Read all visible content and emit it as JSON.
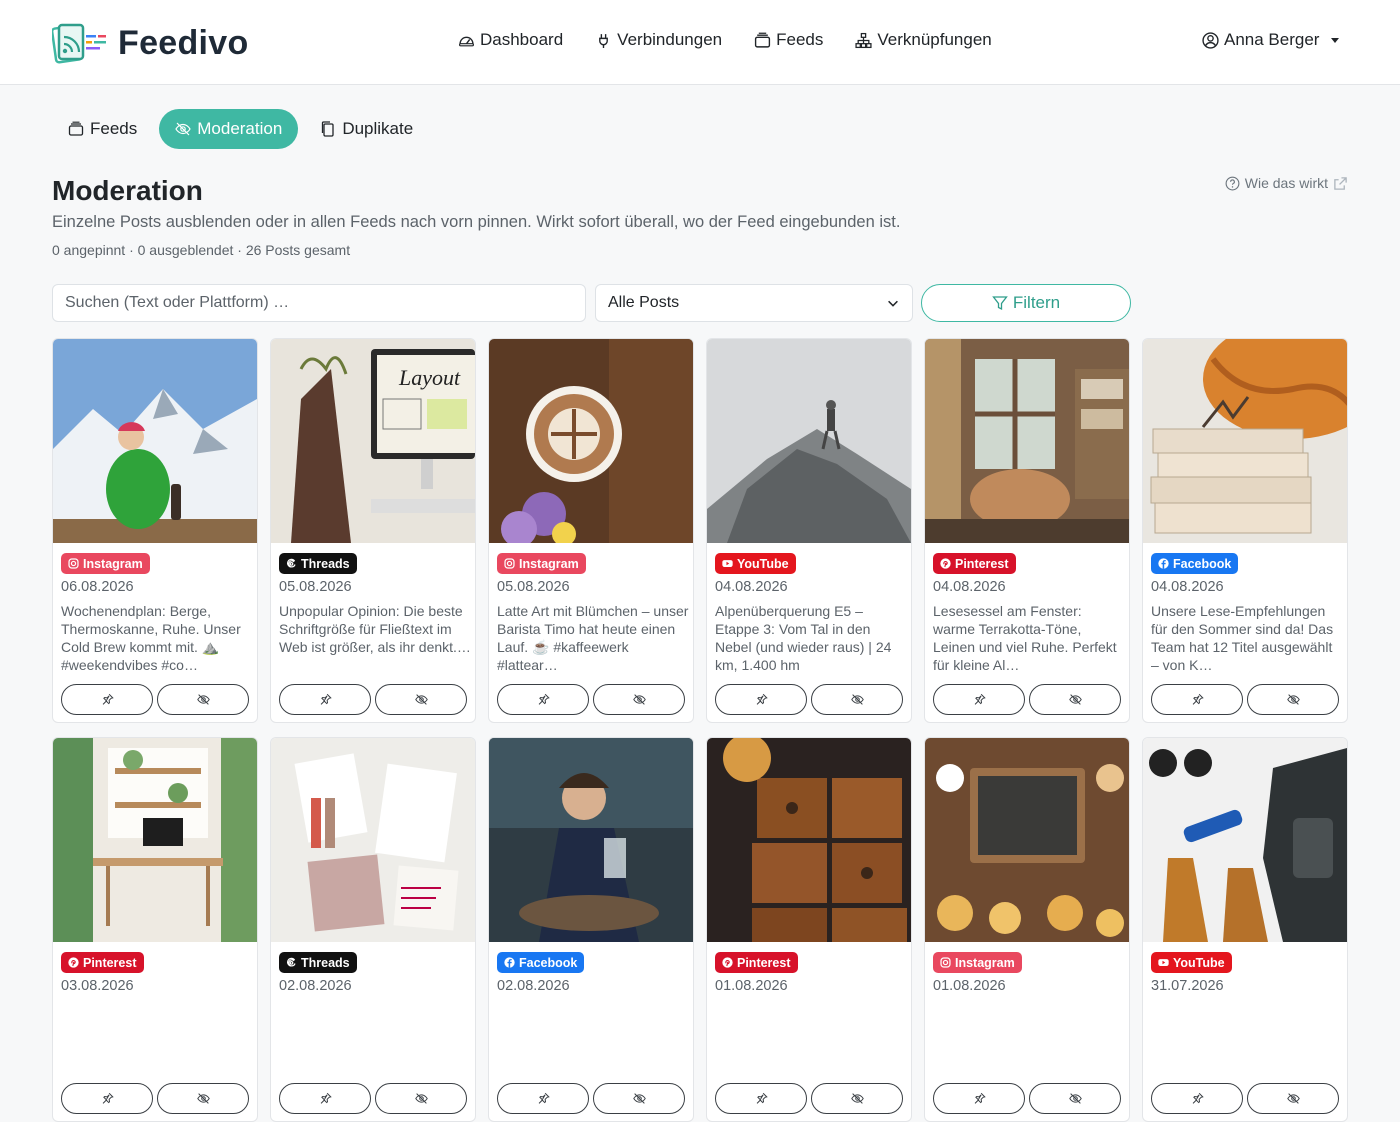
{
  "app": {
    "name": "Feedivo"
  },
  "nav": [
    {
      "label": "Dashboard",
      "icon": "speedometer-icon"
    },
    {
      "label": "Verbindungen",
      "icon": "plug-icon"
    },
    {
      "label": "Feeds",
      "icon": "stack-icon"
    },
    {
      "label": "Verknüpfungen",
      "icon": "diagram-icon"
    }
  ],
  "user": {
    "name": "Anna Berger"
  },
  "tabs": [
    {
      "label": "Feeds",
      "active": false
    },
    {
      "label": "Moderation",
      "active": true
    },
    {
      "label": "Duplikate",
      "active": false
    }
  ],
  "page": {
    "title": "Moderation",
    "description": "Einzelne Posts ausblenden oder in allen Feeds nach vorn pinnen. Wirkt sofort überall, wo der Feed eingebunden ist.",
    "stats": "0 angepinnt · 0 ausgeblendet · 26 Posts gesamt",
    "help": "Wie das wirkt"
  },
  "filter": {
    "search_placeholder": "Suchen (Text oder Plattform) …",
    "select_value": "Alle Posts",
    "button": "Filtern"
  },
  "platform_colors": {
    "Instagram": "#e9485f",
    "Threads": "#111111",
    "YouTube": "#e4161e",
    "Pinterest": "#d7122a",
    "Facebook": "#1877f2"
  },
  "posts": [
    {
      "platform": "Instagram",
      "date": "06.08.2026",
      "text": "Wochenendplan: Berge, Thermoskanne, Ruhe. Unser Cold Brew kommt mit. ⛰️ #weekendvibes #co…",
      "image": "mountain-hiker"
    },
    {
      "platform": "Threads",
      "date": "05.08.2026",
      "text": "Unpopular Opinion: Die beste Schriftgröße für Fließtext im Web ist größer, als ihr denkt.…",
      "image": "layout-monitor"
    },
    {
      "platform": "Instagram",
      "date": "05.08.2026",
      "text": "Latte Art mit Blümchen – unser Barista Timo hat heute einen Lauf. ☕ #kaffeewerk #lattear…",
      "image": "latte-art"
    },
    {
      "platform": "YouTube",
      "date": "04.08.2026",
      "text": "Alpenüberquerung E5 – Etappe 3: Vom Tal in den Nebel (und wieder raus) | 24 km, 1.400 hm",
      "image": "foggy-summit"
    },
    {
      "platform": "Pinterest",
      "date": "04.08.2026",
      "text": "Lesesessel am Fenster: warme Terrakotta-Töne, Leinen und viel Ruhe. Perfekt für kleine Al…",
      "image": "reading-chair"
    },
    {
      "platform": "Facebook",
      "date": "04.08.2026",
      "text": "Unsere Lese-Empfehlungen für den Sommer sind da! Das Team hat 12 Titel ausgewählt – von K…",
      "image": "book-stack"
    },
    {
      "platform": "Pinterest",
      "date": "03.08.2026",
      "text": "",
      "image": "home-office"
    },
    {
      "platform": "Threads",
      "date": "02.08.2026",
      "text": "",
      "image": "moodboard"
    },
    {
      "platform": "Facebook",
      "date": "02.08.2026",
      "text": "",
      "image": "cafe-woman"
    },
    {
      "platform": "Pinterest",
      "date": "01.08.2026",
      "text": "",
      "image": "brownies"
    },
    {
      "platform": "Instagram",
      "date": "01.08.2026",
      "text": "",
      "image": "chalkboard-pastries"
    },
    {
      "platform": "YouTube",
      "date": "31.07.2026",
      "text": "",
      "image": "hiking-gear"
    }
  ]
}
